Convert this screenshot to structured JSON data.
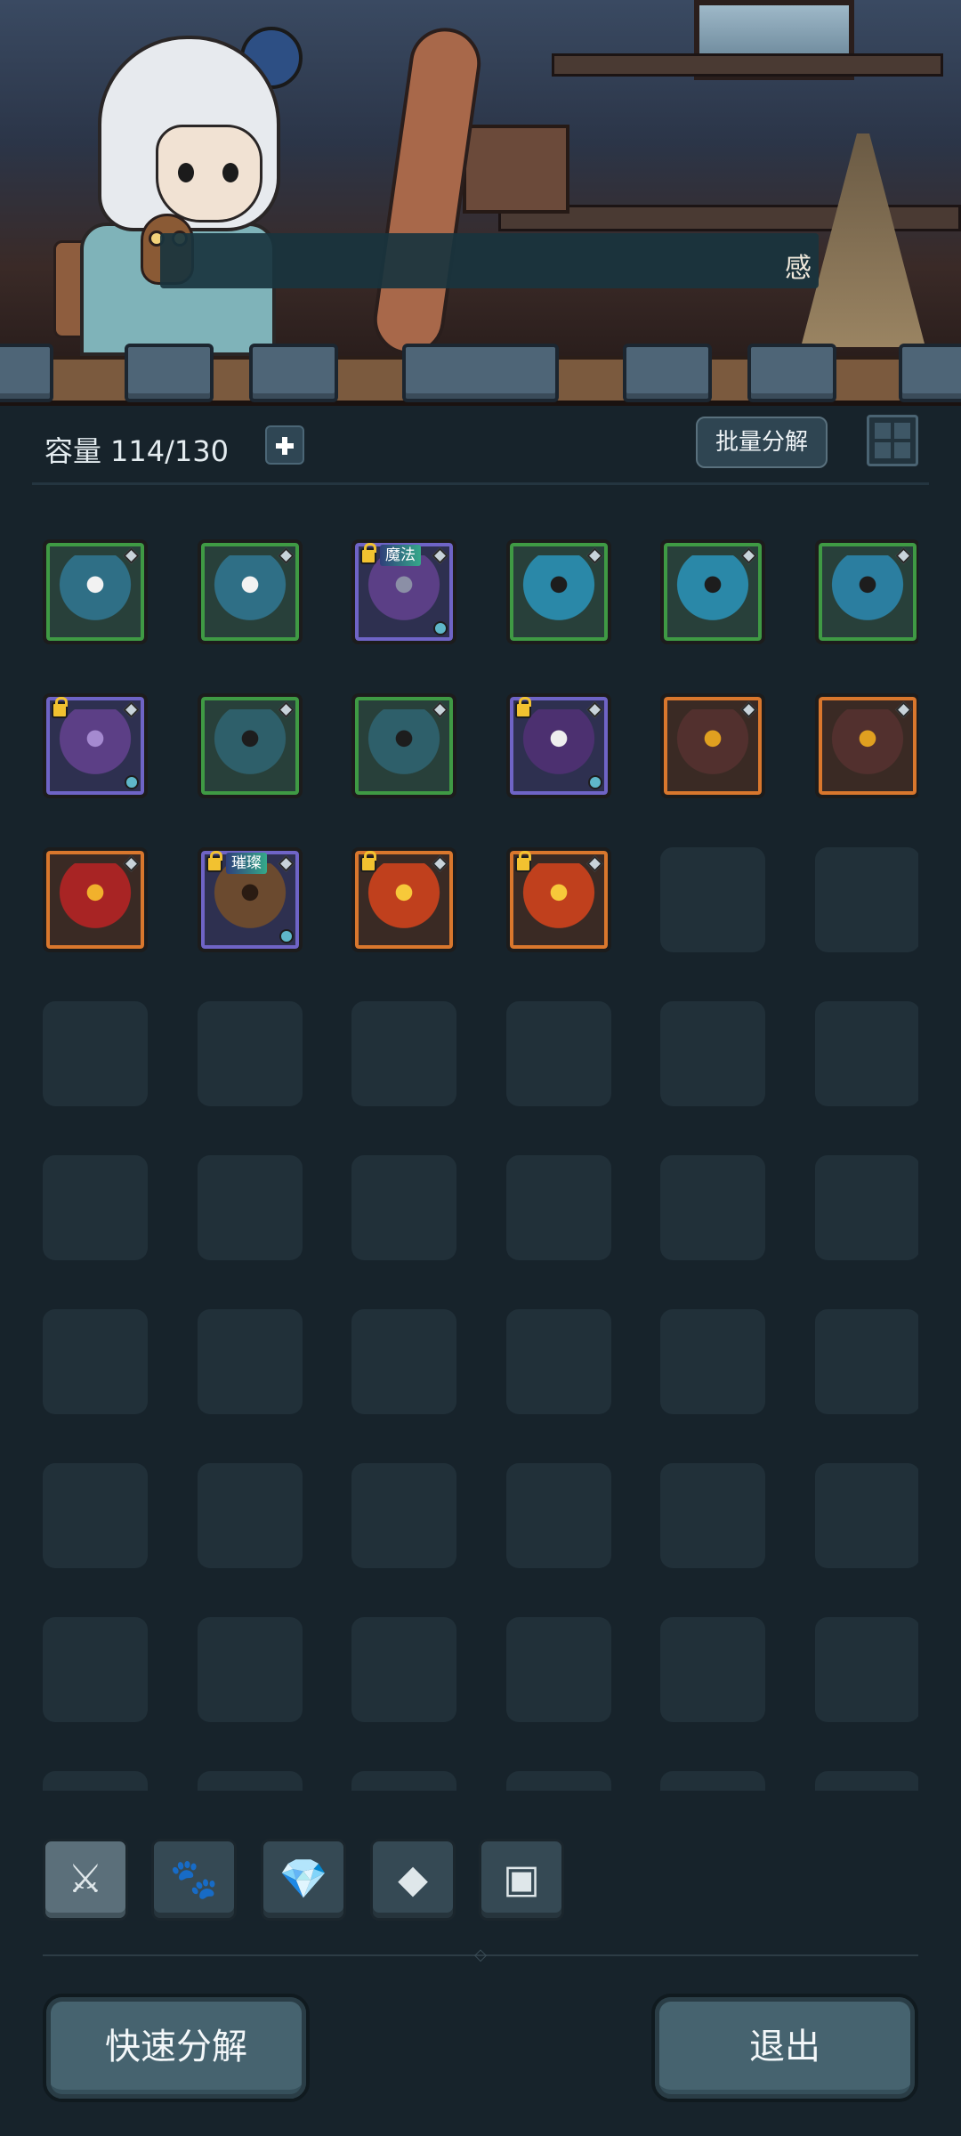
{
  "header": {
    "dialogue_text": "感"
  },
  "toolbar": {
    "capacity_label": "容量",
    "capacity_value": "114/130",
    "batch_decompose_label": "批量分解"
  },
  "inventory": {
    "items": [
      {
        "name": "blue-tunic",
        "rarity": "green",
        "locked": false,
        "badge": ""
      },
      {
        "name": "blue-tunic",
        "rarity": "green",
        "locked": false,
        "badge": ""
      },
      {
        "name": "purple-robe",
        "rarity": "purple",
        "locked": true,
        "badge": "魔法"
      },
      {
        "name": "blue-gloves",
        "rarity": "green",
        "locked": false,
        "badge": ""
      },
      {
        "name": "blue-gloves",
        "rarity": "green",
        "locked": false,
        "badge": ""
      },
      {
        "name": "blue-pants",
        "rarity": "green",
        "locked": false,
        "badge": ""
      },
      {
        "name": "purple-boots",
        "rarity": "purple",
        "locked": true,
        "badge": ""
      },
      {
        "name": "teal-cloak",
        "rarity": "green",
        "locked": false,
        "badge": ""
      },
      {
        "name": "teal-cloak",
        "rarity": "green",
        "locked": false,
        "badge": ""
      },
      {
        "name": "purple-mantle",
        "rarity": "purple",
        "locked": true,
        "badge": ""
      },
      {
        "name": "dark-crossbow",
        "rarity": "orange",
        "locked": false,
        "badge": ""
      },
      {
        "name": "dark-crossbow",
        "rarity": "orange",
        "locked": false,
        "badge": ""
      },
      {
        "name": "crimson-staff",
        "rarity": "orange",
        "locked": false,
        "badge": ""
      },
      {
        "name": "bandage-wrap",
        "rarity": "purple",
        "locked": true,
        "badge": "璀璨"
      },
      {
        "name": "flame-amulet",
        "rarity": "orange",
        "locked": true,
        "badge": ""
      },
      {
        "name": "flame-amulet",
        "rarity": "orange",
        "locked": true,
        "badge": ""
      }
    ]
  },
  "categories": [
    {
      "name": "equipment",
      "icon": "sword-icon",
      "glyph": "⚔",
      "active": true
    },
    {
      "name": "pets",
      "icon": "paw-icon",
      "glyph": "🐾",
      "active": false
    },
    {
      "name": "gems",
      "icon": "gem-icon",
      "glyph": "💎",
      "active": false
    },
    {
      "name": "materials",
      "icon": "ore-icon",
      "glyph": "◆",
      "active": false
    },
    {
      "name": "chests",
      "icon": "chest-icon",
      "glyph": "▣",
      "active": false
    }
  ],
  "footer": {
    "quick_decompose_label": "快速分解",
    "exit_label": "退出"
  },
  "colors": {
    "rarity_green": "#3f9a44",
    "rarity_purple": "#6f64c6",
    "rarity_orange": "#d9772d",
    "background": "#17232b"
  }
}
